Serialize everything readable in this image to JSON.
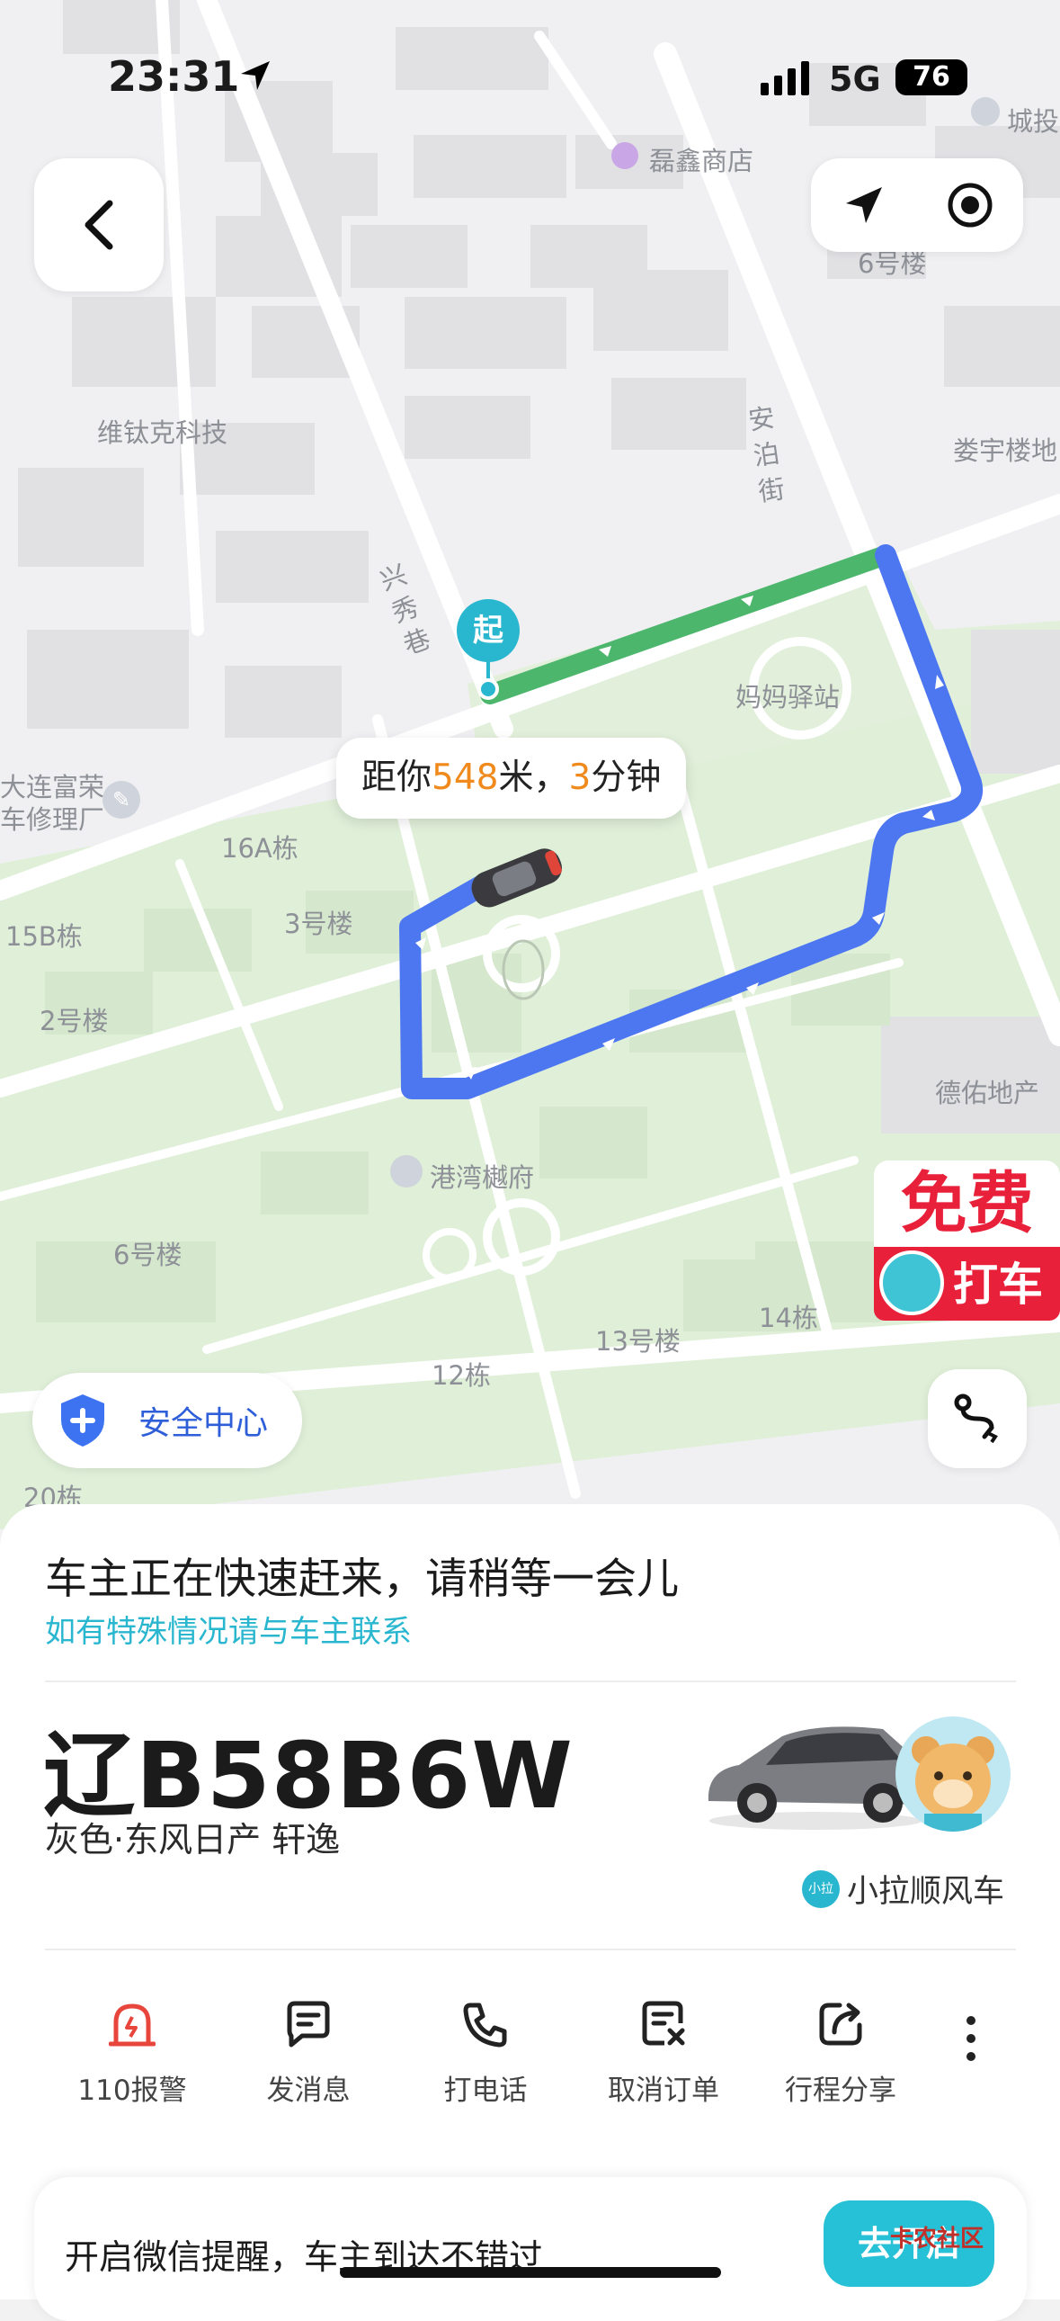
{
  "status_bar": {
    "time": "23:31",
    "network": "5G",
    "battery": "76"
  },
  "map": {
    "labels": {
      "shop": "磊鑫商店",
      "chengtou": "城投",
      "bldg6a": "6号楼",
      "weitaike": "维钛克科技",
      "anbo": "安泊街",
      "louyu": "娄宇楼地",
      "xingxiu": "兴秀巷",
      "mama": "妈妈驿站",
      "dalian1": "大连富荣",
      "dalian2": "车修理厂",
      "b16a": "16A栋",
      "b3": "3号楼",
      "b15b": "15B栋",
      "b2": "2号楼",
      "deyou": "德佑地产",
      "gangwan": "港湾樾府",
      "b6": "6号楼",
      "b13": "13号楼",
      "b14": "14栋",
      "b12": "12栋",
      "b20": "20栋"
    },
    "start_marker": "起",
    "eta": {
      "prefix": "距你",
      "distance": "548",
      "unit": "米，",
      "minutes": "3",
      "suffix": "分钟"
    },
    "promo": {
      "line1": "免费",
      "line2": "打车"
    },
    "safety_center": "安全中心"
  },
  "colors": {
    "route_blue": "#4d77f0",
    "route_green": "#4cb66d",
    "accent_cyan": "#29b6cf",
    "eta_orange": "#f08a1c",
    "alarm_red": "#e8453c"
  },
  "trip": {
    "status_title": "车主正在快速赶来，请稍等一会儿",
    "status_sub": "如有特殊情况请与车主联系",
    "plate": "辽B58B6W",
    "car_desc": "灰色·东风日产 轩逸",
    "service_badge": "小拉",
    "service_name": "小拉顺风车"
  },
  "actions": [
    {
      "label": "110报警",
      "icon": "alarm-icon"
    },
    {
      "label": "发消息",
      "icon": "message-icon"
    },
    {
      "label": "打电话",
      "icon": "phone-icon"
    },
    {
      "label": "取消订单",
      "icon": "cancel-order-icon"
    },
    {
      "label": "行程分享",
      "icon": "share-icon"
    }
  ],
  "wechat_banner": {
    "text": "开启微信提醒，车主到达不错过",
    "button": "去开启"
  },
  "watermark": "卡农社区"
}
